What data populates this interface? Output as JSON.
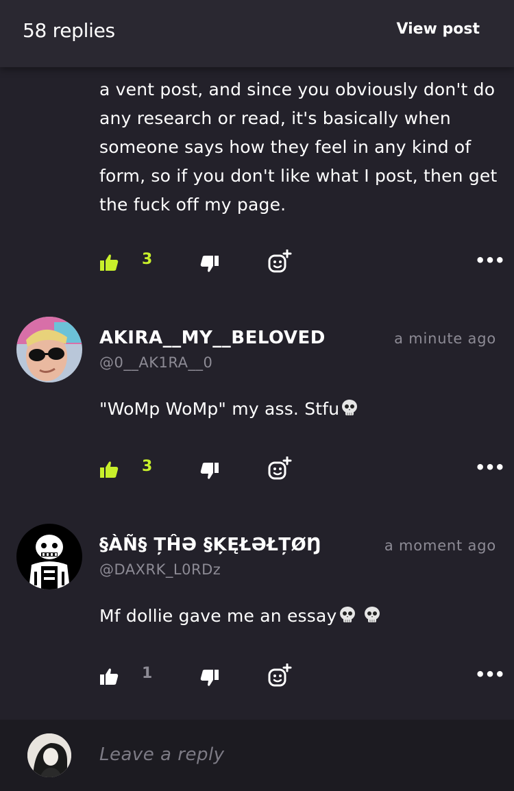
{
  "header": {
    "replies_count": "58 replies",
    "view_post": "View post"
  },
  "comments": [
    {
      "text": "a vent post, and since you obviously don't do any research or read, it's basically when someone says how they feel in any kind of form, so if you don't like what I post, then get the fuck off my page.",
      "likes": "3",
      "liked": true
    },
    {
      "username": "AKIRA__MY__BELOVED",
      "handle": "@0__AK1RA__0",
      "time": "a minute ago",
      "text": "\"WoMp WoMp\" my ass. Stfu",
      "likes": "3",
      "liked": true
    },
    {
      "username": "§ÀÑ§ ȚĤƏ §ĶĘŁƏŁȚØŊ",
      "handle": "@DAXRK_L0RDz",
      "time": "a moment ago",
      "text": "Mf dollie gave me an essay",
      "likes": "1",
      "liked": false
    }
  ],
  "reply_bar": {
    "placeholder": "Leave a reply"
  },
  "icons": {
    "like": "thumbs-up-icon",
    "dislike": "thumbs-down-icon",
    "react": "add-reaction-icon",
    "more": "more-dots-icon",
    "skull": "skull-emoji"
  },
  "colors": {
    "accent": "#c8f02b",
    "background": "#23212a",
    "muted": "#8d8b95"
  }
}
